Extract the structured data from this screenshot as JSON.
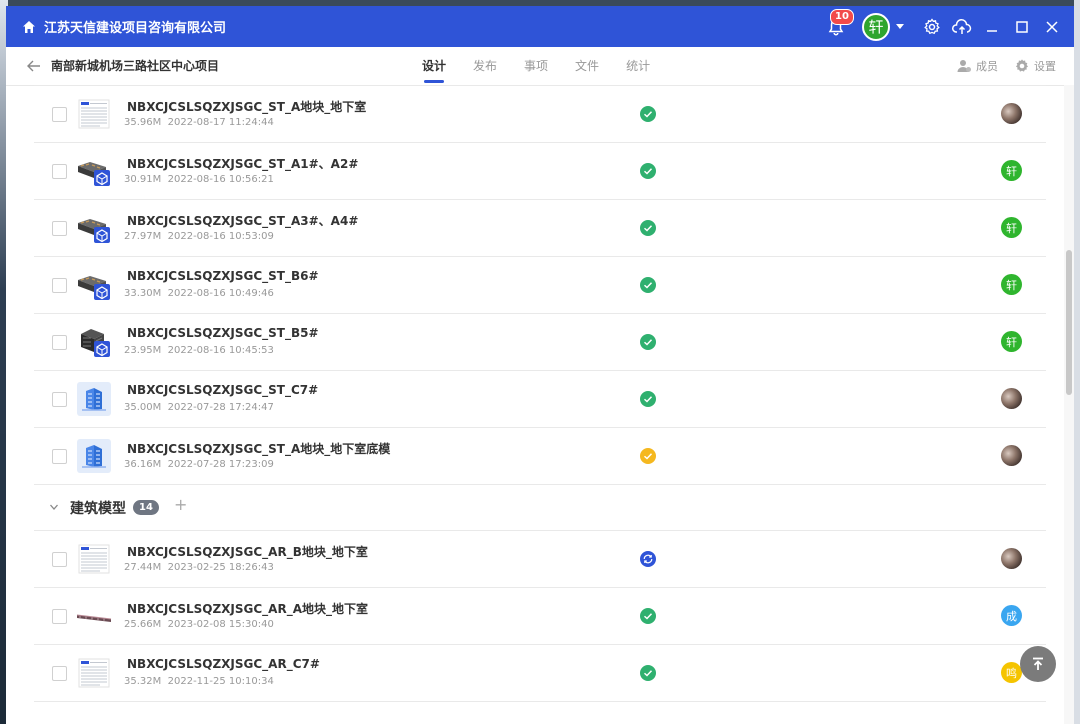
{
  "app": {
    "title": "江苏天信建设项目咨询有限公司",
    "notification_count": "10",
    "user_initial": "轩"
  },
  "nav": {
    "project": "南部新城机场三路社区中心项目",
    "tabs": [
      "设计",
      "发布",
      "事项",
      "文件",
      "统计"
    ],
    "active_tab": "设计",
    "members_label": "成员",
    "settings_label": "设置"
  },
  "files": [
    {
      "name": "NBXCJCSLSQZXJSGC_ST_A地块_地下室",
      "size": "35.96M",
      "time": "2022-08-17 11:24:44",
      "thumb": "document",
      "status": "done",
      "owner": "photo"
    },
    {
      "name": "NBXCJCSLSQZXJSGC_ST_A1#、A2#",
      "size": "30.91M",
      "time": "2022-08-16 10:56:21",
      "thumb": "model",
      "status": "done",
      "owner": "轩"
    },
    {
      "name": "NBXCJCSLSQZXJSGC_ST_A3#、A4#",
      "size": "27.97M",
      "time": "2022-08-16 10:53:09",
      "thumb": "model",
      "status": "done",
      "owner": "轩"
    },
    {
      "name": "NBXCJCSLSQZXJSGC_ST_B6#",
      "size": "33.30M",
      "time": "2022-08-16 10:49:46",
      "thumb": "model",
      "status": "done",
      "owner": "轩"
    },
    {
      "name": "NBXCJCSLSQZXJSGC_ST_B5#",
      "size": "23.95M",
      "time": "2022-08-16 10:45:53",
      "thumb": "model-tall",
      "status": "done",
      "owner": "轩"
    },
    {
      "name": "NBXCJCSLSQZXJSGC_ST_C7#",
      "size": "35.00M",
      "time": "2022-07-28 17:24:47",
      "thumb": "building",
      "status": "done",
      "owner": "photo"
    },
    {
      "name": "NBXCJCSLSQZXJSGC_ST_A地块_地下室底模",
      "size": "36.16M",
      "time": "2022-07-28 17:23:09",
      "thumb": "building",
      "status": "warning",
      "owner": "photo"
    }
  ],
  "group": {
    "name": "建筑模型",
    "count": "14"
  },
  "group_files": [
    {
      "name": "NBXCJCSLSQZXJSGC_AR_B地块_地下室",
      "size": "27.44M",
      "time": "2023-02-25 18:26:43",
      "thumb": "document",
      "status": "processing",
      "owner": "photo"
    },
    {
      "name": "NBXCJCSLSQZXJSGC_AR_A地块_地下室",
      "size": "25.66M",
      "time": "2023-02-08 15:30:40",
      "thumb": "beam",
      "status": "done",
      "owner": "成"
    },
    {
      "name": "NBXCJCSLSQZXJSGC_AR_C7#",
      "size": "35.32M",
      "time": "2022-11-25 10:10:34",
      "thumb": "document",
      "status": "done",
      "owner": "鸣"
    }
  ],
  "colors": {
    "brand": "#2f54d7",
    "done": "#2fb06f",
    "warning": "#f5b81f",
    "processing": "#2f54d7"
  }
}
